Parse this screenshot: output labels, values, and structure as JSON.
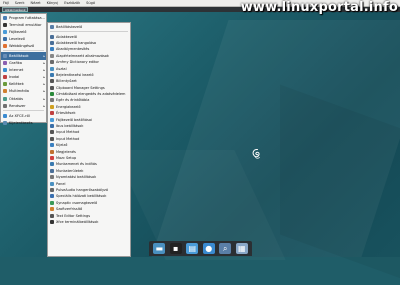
{
  "menubar": {
    "items": [
      "Fájl",
      "Szerk",
      "Nézet",
      "Könyvj",
      "Eszközök",
      "Súgó"
    ]
  },
  "window_title": "Alkalmazások",
  "watermark": "www.linuxportal.info",
  "left_menu": {
    "items": [
      {
        "label": "Program futtatása...",
        "color": "#4a7fb5"
      },
      {
        "label": "Terminál emulátor",
        "color": "#333"
      },
      {
        "label": "Fájlkezelő",
        "color": "#4a9bd8"
      },
      {
        "label": "Levelező",
        "color": "#3a6fa8"
      },
      {
        "label": "Webböngésző",
        "color": "#e07030"
      },
      {
        "label": "Beállítások",
        "color": "#6a8fb8",
        "selected": true,
        "submenu": true
      },
      {
        "label": "Grafika",
        "color": "#8a5fb0",
        "submenu": true
      },
      {
        "label": "Internet",
        "color": "#3a8fd0",
        "submenu": true
      },
      {
        "label": "Irodai",
        "color": "#c04040",
        "submenu": true
      },
      {
        "label": "Kellékek",
        "color": "#6a9a3a",
        "submenu": true
      },
      {
        "label": "Multimédia",
        "color": "#d08030",
        "submenu": true
      },
      {
        "label": "Oktatás",
        "color": "#4a9a8a",
        "submenu": true
      },
      {
        "label": "Rendszer",
        "color": "#707070",
        "submenu": true
      },
      {
        "label": "Az XFCE-ről",
        "color": "#3a8ad0"
      },
      {
        "label": "Kijelentkezés",
        "color": "#5a8ab0"
      }
    ]
  },
  "submenu": {
    "items": [
      {
        "label": "Beállításkezelő",
        "color": "#5a7fa8"
      },
      {
        "label": "Ablakkezelő",
        "color": "#4a6f98"
      },
      {
        "label": "Ablakkezelő hangolása",
        "color": "#4a6f98"
      },
      {
        "label": "Akadálymentesítés",
        "color": "#3a80c0"
      },
      {
        "label": "Alapértelmezett alkalmazások",
        "color": "#888"
      },
      {
        "label": "Amfmy Dictionary editor",
        "color": "#6a6a6a"
      },
      {
        "label": "Asztal",
        "color": "#4a90c0"
      },
      {
        "label": "Bejelentkezési kezelő",
        "color": "#3a7ab0"
      },
      {
        "label": "Billentyűzet",
        "color": "#555"
      },
      {
        "label": "Clipboard Manager Settings",
        "color": "#555"
      },
      {
        "label": "Címtáblázat elengedés és adatvédelem",
        "color": "#2a8a3a"
      },
      {
        "label": "Egér és érintőtábla",
        "color": "#777"
      },
      {
        "label": "Energiakezelő",
        "color": "#d0a020"
      },
      {
        "label": "Értesítések",
        "color": "#c04040"
      },
      {
        "label": "Fájlkezelő beállításai",
        "color": "#4a9bd8"
      },
      {
        "label": "Ibus beállítások",
        "color": "#3a6fa8"
      },
      {
        "label": "Input Method",
        "color": "#555"
      },
      {
        "label": "Input Method",
        "color": "#555"
      },
      {
        "label": "Kijelző",
        "color": "#3a80c0"
      },
      {
        "label": "Megjelenés",
        "color": "#c07030"
      },
      {
        "label": "Mozc Setup",
        "color": "#d04040"
      },
      {
        "label": "Munkamenet és indítás",
        "color": "#3a7ab0"
      },
      {
        "label": "Munkaterületek",
        "color": "#4a6f98"
      },
      {
        "label": "Nyomtatási beállítások",
        "color": "#777"
      },
      {
        "label": "Panel",
        "color": "#4a90c0"
      },
      {
        "label": "PulseAudio hangerőszabályzó",
        "color": "#666"
      },
      {
        "label": "Speciális hálózati beállítások",
        "color": "#3a70b0"
      },
      {
        "label": "Synaptic csomagkezelő",
        "color": "#3a9a5a"
      },
      {
        "label": "Szoftverfrissítő",
        "color": "#d08030"
      },
      {
        "label": "Text Editor Settings",
        "color": "#555"
      },
      {
        "label": "Xfce terminálbeállítások",
        "color": "#333"
      }
    ]
  },
  "taskbar": {
    "items": [
      {
        "name": "show-desktop",
        "color": "#4a90c0",
        "glyph": "▬"
      },
      {
        "name": "terminal",
        "color": "#222",
        "glyph": "▪"
      },
      {
        "name": "file-manager",
        "color": "#4a9bd8",
        "glyph": "▤"
      },
      {
        "name": "web-browser",
        "color": "#3a8ad0",
        "glyph": "●"
      },
      {
        "name": "app-finder",
        "color": "#5a7fa8",
        "glyph": "⌕"
      },
      {
        "name": "files",
        "color": "#8aa8c8",
        "glyph": "▦"
      }
    ]
  }
}
